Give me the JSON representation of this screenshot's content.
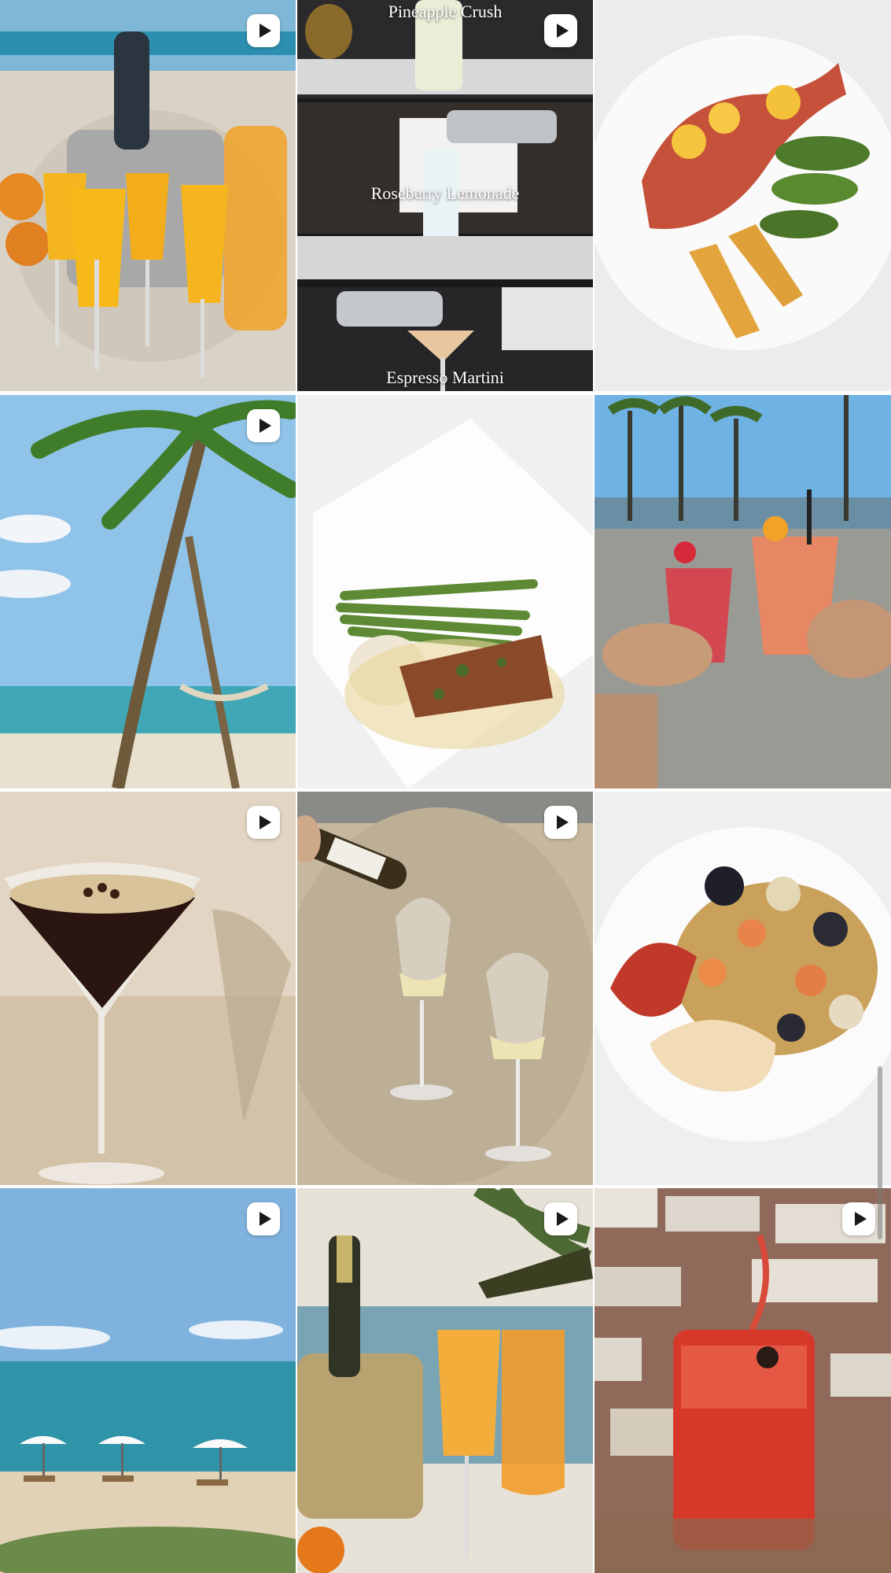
{
  "grid": {
    "tiles": [
      {
        "id": "mimosas-bucket",
        "type": "reel"
      },
      {
        "id": "cocktail-collage",
        "type": "reel",
        "captions": [
          "Pineapple Crush",
          "Roseberry Lemonade",
          "Espresso Martini"
        ]
      },
      {
        "id": "fish-plate",
        "type": "photo"
      },
      {
        "id": "palm-beach",
        "type": "reel"
      },
      {
        "id": "salmon-asparagus",
        "type": "photo"
      },
      {
        "id": "toasting-drinks",
        "type": "photo"
      },
      {
        "id": "espresso-martini",
        "type": "reel"
      },
      {
        "id": "wine-on-sand",
        "type": "reel"
      },
      {
        "id": "seafood-pasta",
        "type": "photo"
      },
      {
        "id": "beach-umbrellas",
        "type": "reel"
      },
      {
        "id": "mimosa-pour",
        "type": "reel"
      },
      {
        "id": "red-cocktail",
        "type": "reel"
      }
    ]
  },
  "colors": {
    "background": "#ffffff",
    "badge": "#ffffff",
    "badge_icon": "#1a1a1a"
  }
}
